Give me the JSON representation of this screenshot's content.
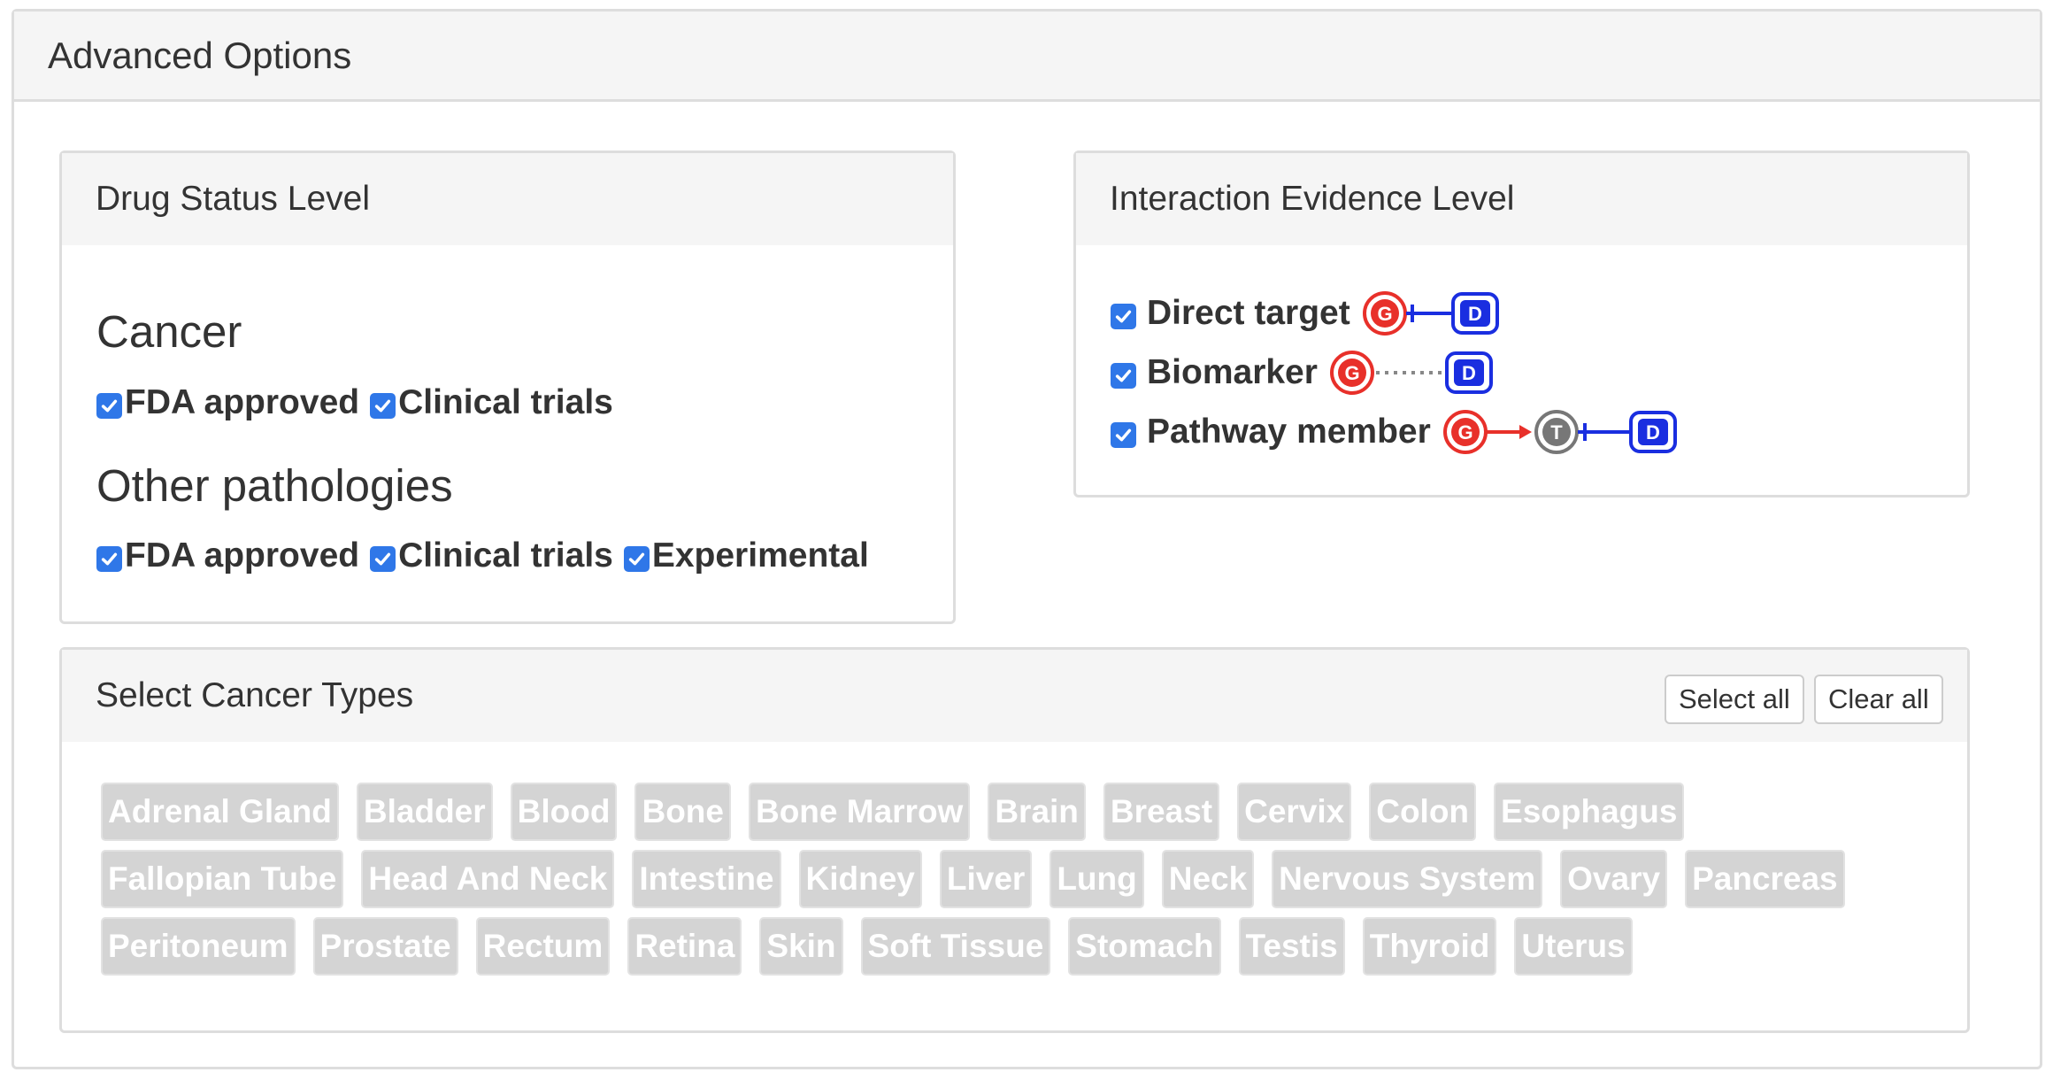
{
  "panel_title": "Advanced Options",
  "drug_status": {
    "title": "Drug Status Level",
    "cancer": {
      "heading": "Cancer",
      "options": [
        {
          "label": "FDA approved",
          "checked": true
        },
        {
          "label": "Clinical trials",
          "checked": true
        }
      ]
    },
    "other": {
      "heading": "Other pathologies",
      "options": [
        {
          "label": "FDA approved",
          "checked": true
        },
        {
          "label": "Clinical trials",
          "checked": true
        },
        {
          "label": "Experimental",
          "checked": true
        }
      ]
    }
  },
  "interaction_evidence": {
    "title": "Interaction Evidence Level",
    "options": [
      {
        "label": "Direct target",
        "checked": true,
        "diagram": "G-inhibits-D"
      },
      {
        "label": "Biomarker",
        "checked": true,
        "diagram": "G-dotted-D"
      },
      {
        "label": "Pathway member",
        "checked": true,
        "diagram": "G-arrow-T-inhibits-D"
      }
    ],
    "node_letters": {
      "gene": "G",
      "target": "T",
      "drug": "D"
    }
  },
  "cancer_types": {
    "title": "Select Cancer Types",
    "select_all_label": "Select all",
    "clear_all_label": "Clear all",
    "tags": [
      "Adrenal Gland",
      "Bladder",
      "Blood",
      "Bone",
      "Bone Marrow",
      "Brain",
      "Breast",
      "Cervix",
      "Colon",
      "Esophagus",
      "Fallopian Tube",
      "Head And Neck",
      "Intestine",
      "Kidney",
      "Liver",
      "Lung",
      "Neck",
      "Nervous System",
      "Ovary",
      "Pancreas",
      "Peritoneum",
      "Prostate",
      "Rectum",
      "Retina",
      "Skin",
      "Soft Tissue",
      "Stomach",
      "Testis",
      "Thyroid",
      "Uterus"
    ]
  },
  "colors": {
    "checkbox": "#2f77e8",
    "gene": "#e8302a",
    "drug": "#1a2ee0",
    "target": "#777777",
    "tag_bg": "#d4d4d4"
  }
}
